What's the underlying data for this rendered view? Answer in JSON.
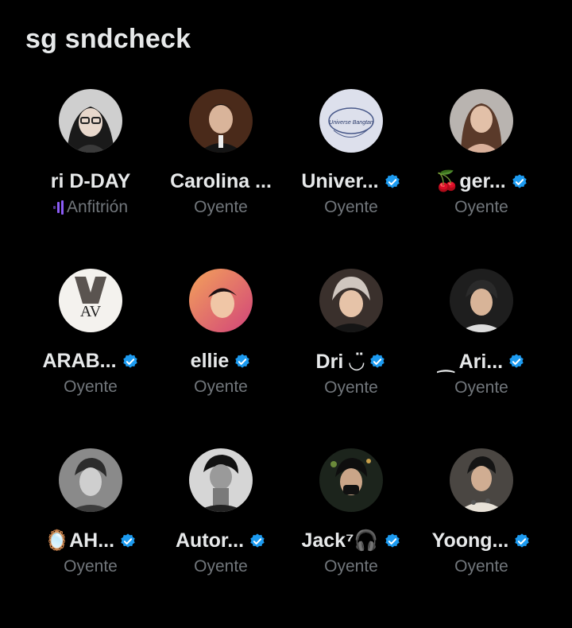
{
  "space": {
    "title": "sg sndcheck"
  },
  "colors": {
    "background": "#000000",
    "text": "#e7e9ea",
    "secondary": "#71767b",
    "verified": "#1d9bf0",
    "host_accent": "#8b5cf6"
  },
  "participants": [
    {
      "name": "ri D-DAY",
      "role": "Anfitrión",
      "verified": false,
      "host": true
    },
    {
      "name": "Carolina ...",
      "role": "Oyente",
      "verified": false
    },
    {
      "name": "Univer...",
      "role": "Oyente",
      "verified": true
    },
    {
      "name": "🍒ger...",
      "role": "Oyente",
      "verified": true
    },
    {
      "name": "ARAB...",
      "role": "Oyente",
      "verified": true
    },
    {
      "name": "ellie",
      "role": "Oyente",
      "verified": true
    },
    {
      "name": "Dri ◡̈",
      "role": "Oyente",
      "verified": true
    },
    {
      "name": "⁔ Ari...",
      "role": "Oyente",
      "verified": true
    },
    {
      "name": "🪞AH...",
      "role": "Oyente",
      "verified": true
    },
    {
      "name": "Autor...",
      "role": "Oyente",
      "verified": true
    },
    {
      "name": "Jack⁷🎧",
      "role": "Oyente",
      "verified": true
    },
    {
      "name": "Yoong...",
      "role": "Oyente",
      "verified": true
    }
  ],
  "avatar_art": {
    "univer_logo_text": "Universe Bangtan",
    "arab_logo_text": "AV"
  }
}
